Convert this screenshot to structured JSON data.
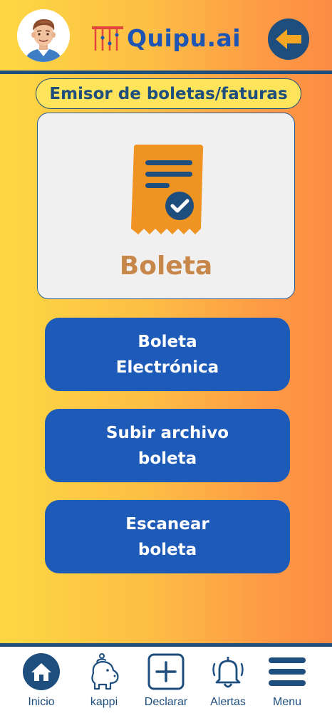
{
  "header": {
    "logo_text": "Quipu.ai",
    "avatar_icon": "user-avatar-icon",
    "back_icon": "arrow-left-icon"
  },
  "section_title": "Emisor de boletas/faturas",
  "card": {
    "icon": "receipt-check-icon",
    "label": "Boleta"
  },
  "actions": [
    {
      "label": "Boleta\nElectrónica"
    },
    {
      "label": "Subir archivo\nboleta"
    },
    {
      "label": "Escanear\nboleta"
    }
  ],
  "nav": {
    "items": [
      {
        "label": "Inicio",
        "icon": "home-icon"
      },
      {
        "label": "kappi",
        "icon": "capybara-icon"
      },
      {
        "label": "Declarar",
        "icon": "plus-square-icon"
      },
      {
        "label": "Alertas",
        "icon": "bell-icon"
      },
      {
        "label": "Menu",
        "icon": "hamburger-menu-icon"
      }
    ]
  },
  "colors": {
    "primary_blue": "#1E5BB8",
    "dark_blue": "#1E4E7E",
    "receipt_orange": "#EF9322",
    "label_brown": "#C8874A",
    "back_arrow": "#F5A623"
  }
}
